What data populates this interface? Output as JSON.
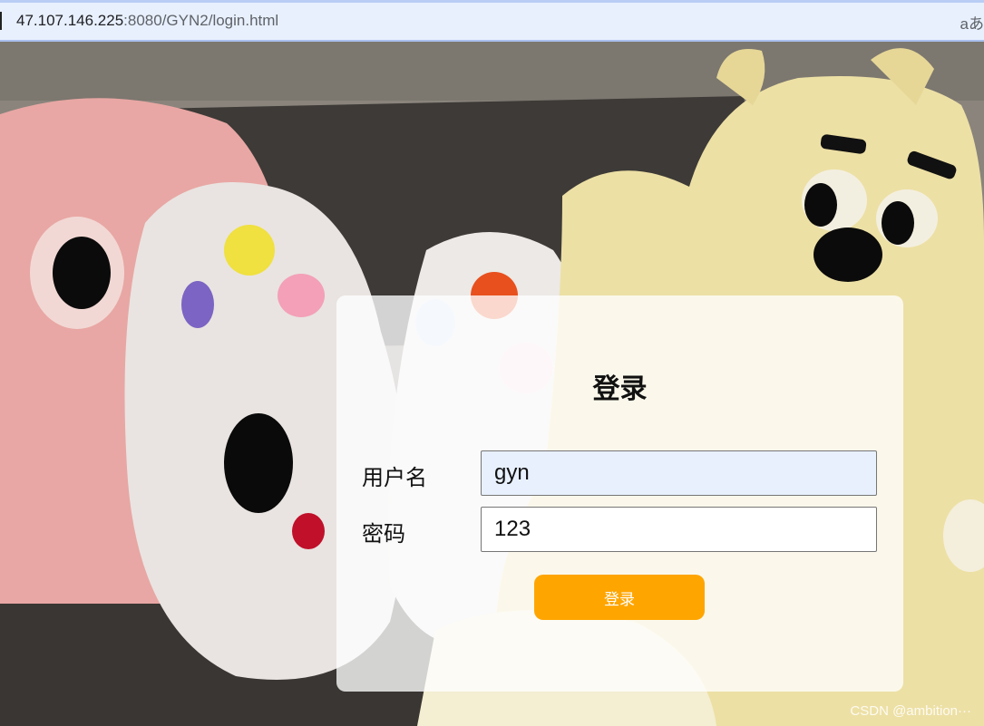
{
  "browser": {
    "url_host": "47.107.146.225",
    "url_path": ":8080/GYN2/login.html",
    "translate_label": "aあ"
  },
  "login": {
    "title": "登录",
    "username_label": "用户名",
    "username_value": "gyn",
    "password_label": "密码",
    "password_value": "123",
    "submit_label": "登录"
  },
  "watermark": "CSDN @ambition···",
  "colors": {
    "button": "#ffa500",
    "autofill": "#e8f0fe"
  }
}
